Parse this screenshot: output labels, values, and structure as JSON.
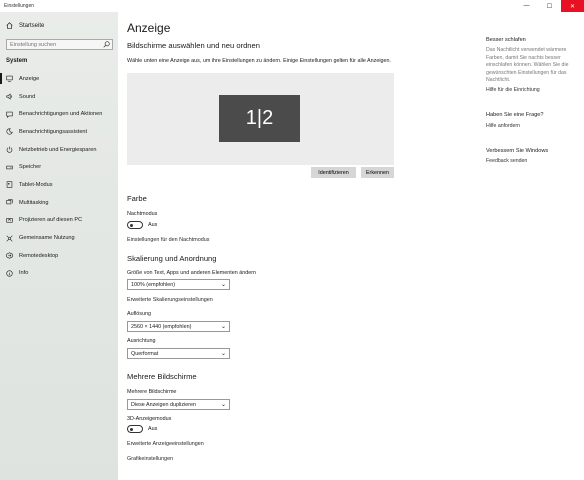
{
  "window": {
    "title": "Einstellungen",
    "minimize": "—",
    "maximize": "☐",
    "close": "✕"
  },
  "sidebar": {
    "home": "Startseite",
    "search_placeholder": "Einstellung suchen",
    "section": "System",
    "items": [
      {
        "label": "Anzeige",
        "icon": "monitor-icon",
        "active": true
      },
      {
        "label": "Sound",
        "icon": "speaker-icon"
      },
      {
        "label": "Benachrichtigungen und Aktionen",
        "icon": "message-icon"
      },
      {
        "label": "Benachrichtigungsassistent",
        "icon": "moon-icon"
      },
      {
        "label": "Netzbetrieb und Energiesparen",
        "icon": "power-icon"
      },
      {
        "label": "Speicher",
        "icon": "storage-icon"
      },
      {
        "label": "Tablet-Modus",
        "icon": "tablet-icon"
      },
      {
        "label": "Multitasking",
        "icon": "multitask-icon"
      },
      {
        "label": "Projizieren auf diesen PC",
        "icon": "project-icon"
      },
      {
        "label": "Gemeinsame Nutzung",
        "icon": "share-icon"
      },
      {
        "label": "Remotedesktop",
        "icon": "remote-icon"
      },
      {
        "label": "Info",
        "icon": "info-icon"
      }
    ]
  },
  "main": {
    "title": "Anzeige",
    "arrange_heading": "Bildschirme auswählen und neu ordnen",
    "arrange_desc": "Wähle unten eine Anzeige aus, um ihre Einstellungen zu ändern. Einige Einstellungen gelten für alle Anzeigen.",
    "monitor_label": "1|2",
    "identify_button": "Identifizieren",
    "detect_button": "Erkennen",
    "color_heading": "Farbe",
    "night_mode_label": "Nachtmodus",
    "night_mode_state": "Aus",
    "night_mode_link": "Einstellungen für den Nachtmodus",
    "scale_heading": "Skalierung und Anordnung",
    "scale_label": "Größe von Text, Apps und anderen Elementen ändern",
    "scale_value": "100% (empfohlen)",
    "scale_link": "Erweiterte Skalierungseinstellungen",
    "resolution_label": "Auflösung",
    "resolution_value": "2560 × 1440 (empfohlen)",
    "orientation_label": "Ausrichtung",
    "orientation_value": "Querformat",
    "multi_heading": "Mehrere Bildschirme",
    "multi_label": "Mehrere Bildschirme",
    "multi_value": "Diese Anzeigen duplizieren",
    "mode3d_label": "3D-Anzeigemodus",
    "mode3d_state": "Aus",
    "advanced_link": "Erweiterte Anzeigeeinstellungen",
    "graphics_link": "Grafikeinstellungen"
  },
  "right": {
    "sleep_heading": "Besser schlafen",
    "sleep_text": "Das Nachtlicht verwendet wärmere Farben, damit Sie nachts besser einschlafen können. Wählen Sie die gewünschten Einstellungen für das Nachtlicht.",
    "sleep_link": "Hilfe für die Einrichtung",
    "question_heading": "Haben Sie eine Frage?",
    "question_link": "Hilfe anfordern",
    "improve_heading": "Verbessern Sie Windows",
    "improve_link": "Feedback senden"
  }
}
